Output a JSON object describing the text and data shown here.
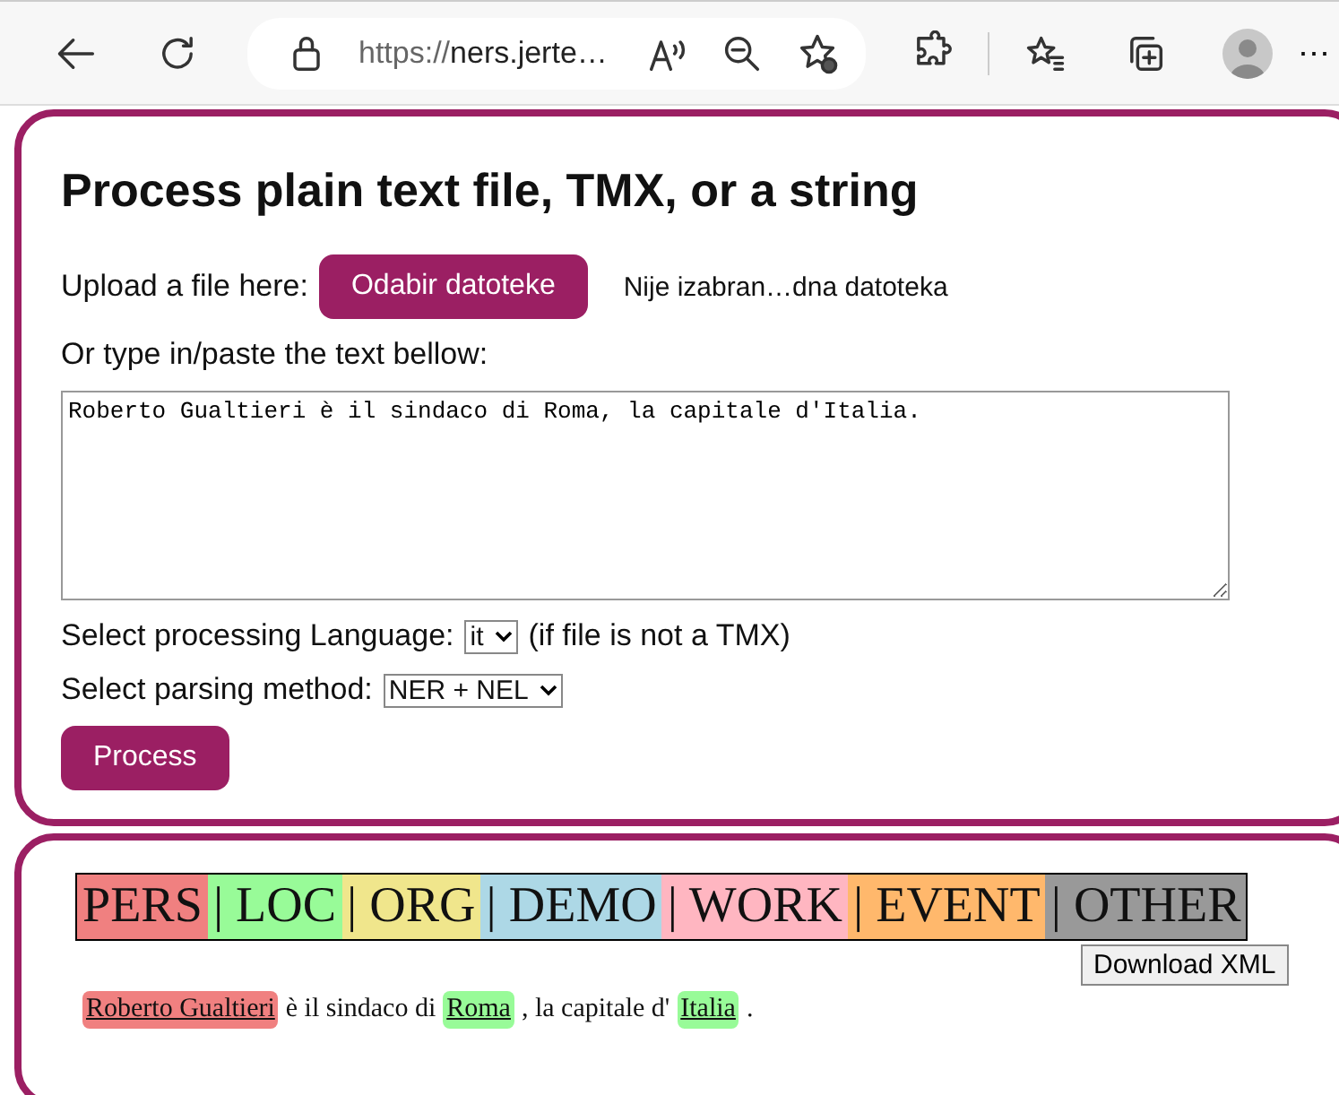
{
  "browser": {
    "url_scheme": "https://",
    "url_host": "ners.jerte…",
    "more": "⋯"
  },
  "form": {
    "title": "Process plain text file, TMX, or a string",
    "upload_label": "Upload a file here:",
    "upload_button": "Odabir datoteke",
    "file_status": "Nije izabran…dna datoteka",
    "text_label": "Or type in/paste the text bellow:",
    "text_value": "Roberto Gualtieri è il sindaco di Roma, la capitale d'Italia.",
    "language_label": "Select processing Language:",
    "language_value": "it",
    "language_note": "(if file is not a TMX)",
    "method_label": "Select parsing method:",
    "method_value": "NER + NEL",
    "process_button": "Process"
  },
  "results": {
    "legend": [
      {
        "label": "PERS",
        "color": "#f08080"
      },
      {
        "label": "| LOC",
        "color": "#98fb98"
      },
      {
        "label": "| ORG",
        "color": "#f0e68c"
      },
      {
        "label": "| DEMO",
        "color": "#add8e6"
      },
      {
        "label": "| WORK",
        "color": "#ffb6c1"
      },
      {
        "label": "| EVENT",
        "color": "#ffb86c"
      },
      {
        "label": "| OTHER",
        "color": "#999999"
      }
    ],
    "download_button": "Download XML",
    "tokens": [
      {
        "kind": "entity",
        "text": "Roberto Gualtieri",
        "color": "#f08080"
      },
      {
        "kind": "text",
        "text": "è il sindaco di"
      },
      {
        "kind": "entity",
        "text": "Roma",
        "color": "#98fb98"
      },
      {
        "kind": "text",
        "text": ", la capitale d'"
      },
      {
        "kind": "entity",
        "text": "Italia",
        "color": "#98fb98"
      },
      {
        "kind": "text",
        "text": "."
      }
    ]
  }
}
